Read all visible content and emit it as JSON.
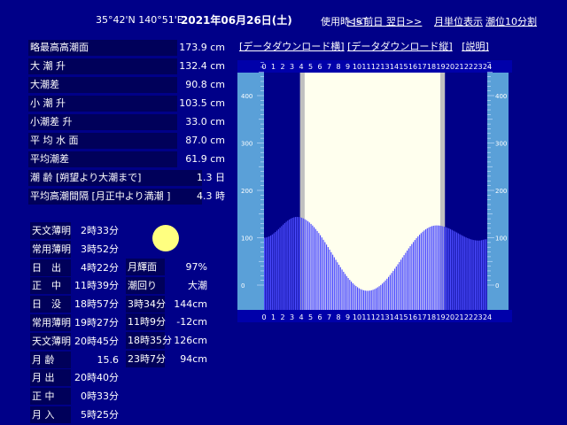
{
  "header": {
    "coords": "35°42'N 140°51'E",
    "date": "2021年06月26日(土)",
    "timezone": "使用時 JST",
    "prev_next": "<<前日 翌日>>",
    "monthly": "月単位表示",
    "interval": "潮位10分割"
  },
  "stats": [
    {
      "label": "略最高高潮面",
      "value": "173.9 cm"
    },
    {
      "label": "大 潮 升",
      "value": "132.4 cm"
    },
    {
      "label": "大潮差",
      "value": "90.8 cm"
    },
    {
      "label": "小 潮 升",
      "value": "103.5 cm"
    },
    {
      "label": "小潮差 升",
      "value": "33.0 cm"
    },
    {
      "label": "平 均 水 面",
      "value": "87.0 cm"
    },
    {
      "label": "平均潮差",
      "value": "61.9 cm"
    },
    {
      "label": "潮 齢 [朔望より大潮まで]",
      "value": "1.3 日"
    },
    {
      "label": "平均高潮間隔 [月正中より満潮 ]",
      "value": "4.3 時"
    }
  ],
  "links": {
    "dl_h": "[データダウンロード横]",
    "dl_v": "[データダウンロード縦]",
    "help": "[説明]"
  },
  "times": [
    {
      "label": "天文薄明",
      "value": "2時33分"
    },
    {
      "label": "常用薄明",
      "value": "3時52分"
    },
    {
      "label": "日　出",
      "value": "4時22分"
    },
    {
      "label": "正　中",
      "value": "11時39分"
    },
    {
      "label": "日　没",
      "value": "18時57分"
    },
    {
      "label": "常用薄明",
      "value": "19時27分"
    },
    {
      "label": "天文薄明",
      "value": "20時45分"
    },
    {
      "label": "月 齢",
      "value": "15.6"
    },
    {
      "label": "月 出",
      "value": "20時40分"
    },
    {
      "label": "正 中",
      "value": "0時33分"
    },
    {
      "label": "月 入",
      "value": "5時25分"
    }
  ],
  "moon_info": [
    {
      "label": "月輝面",
      "value": "97%"
    },
    {
      "label": "潮回り",
      "value": "大潮"
    },
    {
      "label": "3時34分",
      "value": "144cm"
    },
    {
      "label": "11時9分",
      "value": "-12cm"
    },
    {
      "label": "18時35分",
      "value": "126cm"
    },
    {
      "label": "23時7分",
      "value": "94cm"
    }
  ],
  "chart_data": {
    "type": "bar",
    "x_ticks": [
      "0",
      "1",
      "2",
      "3",
      "4",
      "5",
      "6",
      "7",
      "8",
      "9",
      "10",
      "11",
      "12",
      "13",
      "14",
      "15",
      "16",
      "17",
      "18",
      "19",
      "20",
      "21",
      "22",
      "23",
      "24"
    ],
    "y_ticks": [
      "400",
      "300",
      "200",
      "100",
      "0"
    ],
    "ylim": [
      -40,
      440
    ],
    "xlim": [
      0,
      24
    ],
    "daylight": [
      4.37,
      18.95
    ],
    "twilight": [
      3.87,
      19.45
    ],
    "tide_extremes": [
      {
        "t": 0.0,
        "h": 100
      },
      {
        "t": 3.57,
        "h": 144
      },
      {
        "t": 11.15,
        "h": -12
      },
      {
        "t": 18.58,
        "h": 126
      },
      {
        "t": 23.12,
        "h": 94
      },
      {
        "t": 24.0,
        "h": 97
      }
    ],
    "colors": {
      "tide": "#4c4cff",
      "day": "#ffffee",
      "twilight": "#c0c0c0",
      "night": "#000088",
      "scale": "#5aa0d8"
    }
  }
}
